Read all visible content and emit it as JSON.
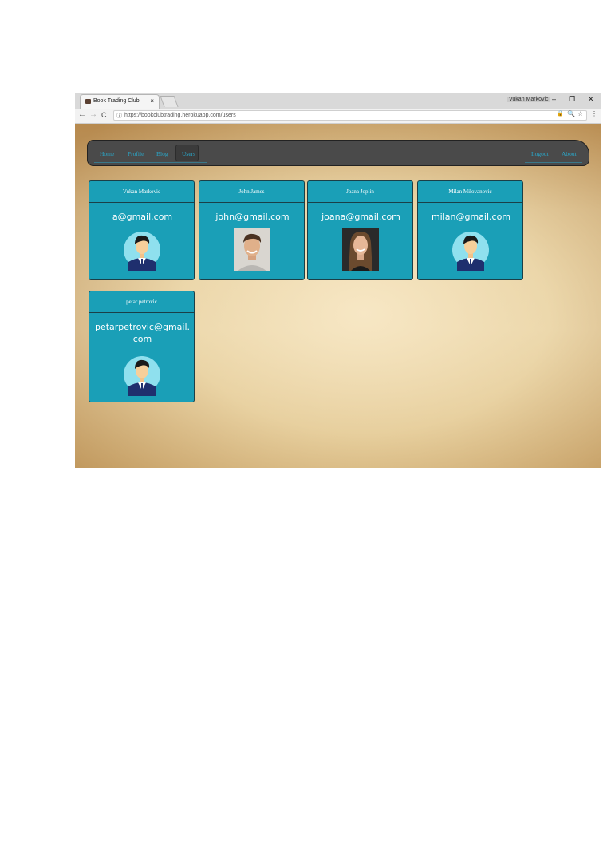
{
  "browser": {
    "tab_title": "Book Trading Club",
    "tab_close": "×",
    "user_label": "Vukan Markovic",
    "window_controls": [
      "–",
      "❐",
      "✕"
    ],
    "nav_glyphs": [
      "←",
      "→",
      "C"
    ],
    "url_info_glyph": "ⓘ",
    "url": "https://bookclubtrading.herokuapp.com/users",
    "ext_glyphs": [
      "🔒",
      "🔍",
      "☆",
      "⋮"
    ]
  },
  "navbar": {
    "left": [
      "Home",
      "Profile",
      "Blog"
    ],
    "active": "Users",
    "right": [
      "Logout",
      "About"
    ]
  },
  "users": [
    {
      "name": "Vukan Markovic",
      "email": "a@gmail.com",
      "avatar": "default-avatar"
    },
    {
      "name": "John James",
      "email": "john@gmail.com",
      "avatar": "photo-man"
    },
    {
      "name": "Joana Joplin",
      "email": "joana@gmail.com",
      "avatar": "photo-woman"
    },
    {
      "name": "Milan Milovanovic",
      "email": "milan@gmail.com",
      "avatar": "default-avatar"
    },
    {
      "name": "petar petrovic",
      "email": "petarpetrovic@gmail.com",
      "avatar": "default-avatar"
    }
  ],
  "colors": {
    "card": "#1a9fb7",
    "navbar": "#4a4a4a",
    "link": "#2aa7c9"
  }
}
